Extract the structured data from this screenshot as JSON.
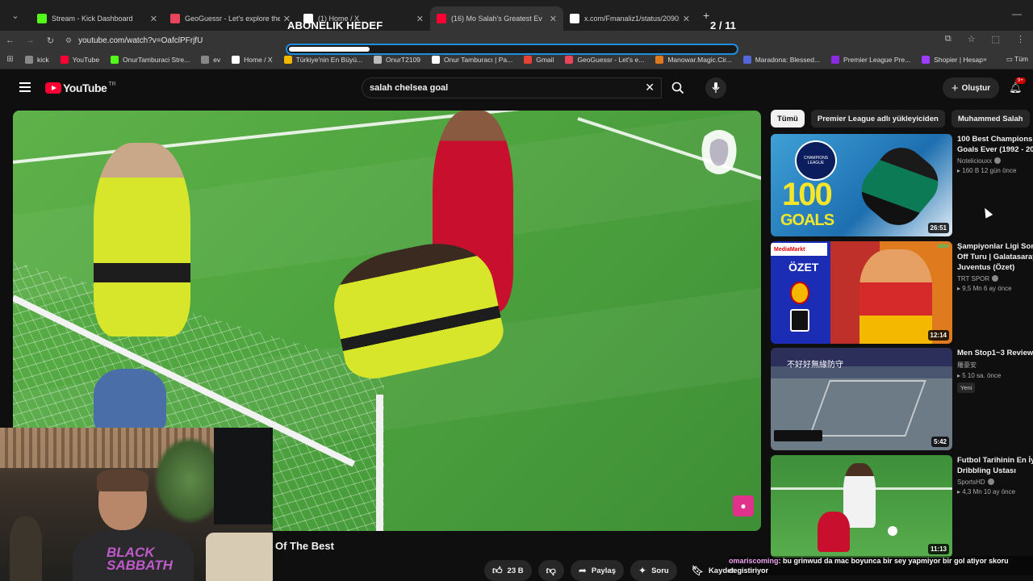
{
  "browser": {
    "tabs": [
      {
        "title": "Stream - Kick Dashboard",
        "color": "#53fc18",
        "active": false
      },
      {
        "title": "GeoGuessr - Let's explore the w",
        "color": "#e8445a",
        "active": false
      },
      {
        "title": "(1) Home / X",
        "color": "#ffffff",
        "active": false
      },
      {
        "title": "(16) Mo Salah's Greatest Ev",
        "color": "#ff0033",
        "active": true
      },
      {
        "title": "x.com/Fmanaliz1/status/20901",
        "color": "#ffffff",
        "active": false
      }
    ],
    "url": "youtube.com/watch?v=OafclPFrjfU",
    "bookmarks": [
      {
        "label": "kick",
        "color": "#888888"
      },
      {
        "label": "YouTube",
        "color": "#ff0033"
      },
      {
        "label": "OnurTamburaci Stre...",
        "color": "#53fc18"
      },
      {
        "label": "ev",
        "color": "#888888"
      },
      {
        "label": "Home / X",
        "color": "#ffffff"
      },
      {
        "label": "Türkiye'nin En Büyü...",
        "color": "#f5b800"
      },
      {
        "label": "OnurT2109",
        "color": "#bbbbbb"
      },
      {
        "label": "Onur Tamburacı | Pa...",
        "color": "#ffffff"
      },
      {
        "label": "Gmail",
        "color": "#ea4335"
      },
      {
        "label": "GeoGuessr - Let's e...",
        "color": "#e8445a"
      },
      {
        "label": "Manowar.Magic.Cir...",
        "color": "#e07a1e"
      },
      {
        "label": "Maradona: Blessed...",
        "color": "#5566dd"
      },
      {
        "label": "Premier League Pre...",
        "color": "#8a2be2"
      },
      {
        "label": "Shopier | Hesap",
        "color": "#9b3cff"
      }
    ],
    "bookmarks_more": "»",
    "bookmarks_folder": "Tüm"
  },
  "overlay": {
    "goal_title": "ABONELIK HEDEF",
    "goal_count": "2 / 11",
    "goal_progress": 0.18
  },
  "youtube": {
    "logo_text": "YouTube",
    "country": "TR",
    "search_query": "salah chelsea goal",
    "create_label": "Oluştur",
    "notif_count": "9+"
  },
  "video": {
    "title": "Of The Best",
    "actions": {
      "likes": "23 B",
      "share": "Paylaş",
      "ask": "Soru",
      "save": "Kaydet"
    }
  },
  "webcam": {
    "shirt_text": "BLACK SABBATH"
  },
  "chips": [
    "Tümü",
    "Premier League adlı yükleyiciden",
    "Muhammed Salah"
  ],
  "recommendations": [
    {
      "title1": "100 Best Champions L",
      "title2": "Goals Ever (1992 - 20",
      "channel": "Noteliciouxx",
      "meta": "160 B  12 gün önce",
      "duration": "26:51",
      "new": ""
    },
    {
      "title1": "Şampiyonlar Ligi Son",
      "title2": "Off Turu | Galatasaray",
      "title3": "Juventus (Özet)",
      "channel": "TRT SPOR",
      "meta": "9,5 Mn  6 ay önce",
      "duration": "12:14",
      "new": ""
    },
    {
      "title1": "Men Stop1~3 Review",
      "title2": "",
      "channel": "羅豪安",
      "meta": "5  10 sa. önce",
      "duration": "5:42",
      "new": "Yeni"
    },
    {
      "title1": "Futbol Tarihinin En İyi",
      "title2": "Dribbling Ustası",
      "channel": "SportsHD",
      "meta": "4,3 Mn  10 ay önce",
      "duration": "11:13",
      "new": ""
    }
  ],
  "thumb_texts": {
    "t1_big": "100",
    "t1_sub": "GOALS",
    "t1_badge": "CHAMPIONS LEAGUE",
    "t2_brand": "MediaMarkt",
    "t2_ozet": "ÖZET",
    "t2_tabii": "tabii",
    "t3_banner": "不好好無緣防守"
  },
  "chat": {
    "user": "omariscoming",
    "message": ": bu grinwud da mac boyunca bir sey yapmiyor bir gol atiyor skoru degistiriyor"
  }
}
